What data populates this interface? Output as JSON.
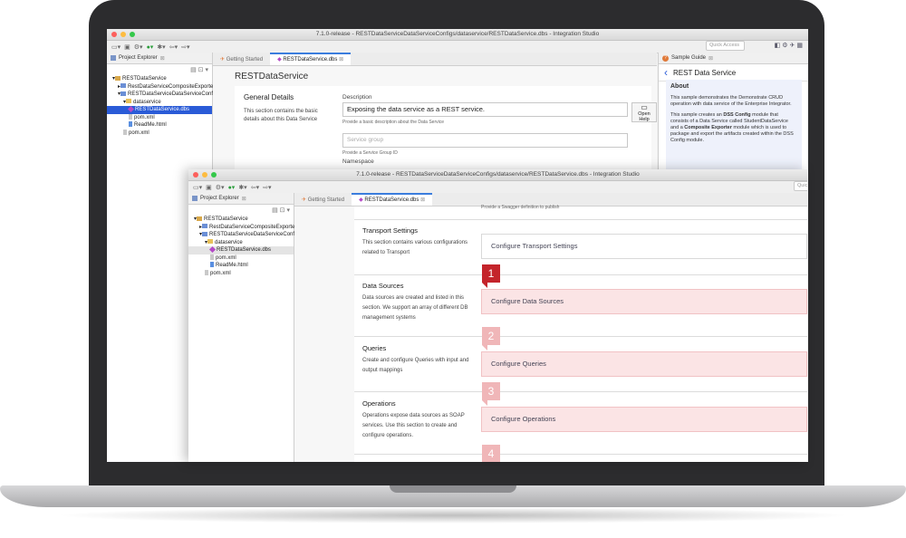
{
  "window": {
    "title": "7.1.0-release - RESTDataServiceDataServiceConfigs/dataservice/RESTDataService.dbs - Integration Studio",
    "quick_access": "Quick Access",
    "quick_access_short": "Quic"
  },
  "explorer": {
    "tab_label": "Project Explorer",
    "items": [
      "RESTDataService",
      "RestDataServiceCompositeExporter",
      "RESTDataServiceDataServiceConfigs",
      "dataservice",
      "RESTDataService.dbs",
      "pom.xml",
      "ReadMe.html",
      "pom.xml"
    ]
  },
  "editor": {
    "tabs": [
      "Getting Started",
      "RESTDataService.dbs"
    ]
  },
  "back_editor": {
    "service_title": "RESTDataService",
    "general_heading": "General Details",
    "general_desc": "This section contains the basic details about this Data Service",
    "description_label": "Description",
    "description_value": "Exposing the data service as a REST service.",
    "description_hint": "Provide a basic description about the Data Service",
    "open_help": "Open Help",
    "service_group_placeholder": "Service group",
    "service_group_hint": "Provide a Service Group ID",
    "namespace_label": "Namespace"
  },
  "sample_guide": {
    "tab_label": "Sample Guide",
    "header": "REST Data Service",
    "about_heading": "About",
    "para1": "This sample demonstrates the Demonstrate CRUD operation with data service of the Enterprise Integrator.",
    "para2_a": "This sample creates an ",
    "para2_b": "DSS Config",
    "para2_c": " module that consists of a Data Service called StudentDataService and a ",
    "para2_d": "Composite Exporter",
    "para2_e": " module which is used to package and export the artifacts created within the DSS Config module."
  },
  "front_editor": {
    "top_hint": "Provide a Swagger definition to publish",
    "sections": [
      {
        "title": "Transport Settings",
        "desc": "This section contains various configurations related to Transport",
        "action": "Configure Transport Settings",
        "badge": ""
      },
      {
        "title": "Data Sources",
        "desc": "Data sources are created and listed in this section. We support an array of different DB management systems",
        "action": "Configure Data Sources",
        "badge": "1"
      },
      {
        "title": "Queries",
        "desc": "Create and configure Queries with input and output mappings",
        "action": "Configure Queries",
        "badge": "2"
      },
      {
        "title": "Operations",
        "desc": "Operations expose data sources as SOAP services. Use this section to create and configure operations.",
        "action": "Configure Operations",
        "badge": "3"
      },
      {
        "title": "",
        "desc": "",
        "action": "",
        "badge": "4"
      }
    ]
  },
  "colors": {
    "badge_active": "#c4242b",
    "badge_faded": "#f0b6b8",
    "highlight_bg": "#fbe4e5",
    "selection": "#2a5bd7",
    "guide_accent": "#2a5bd7"
  }
}
